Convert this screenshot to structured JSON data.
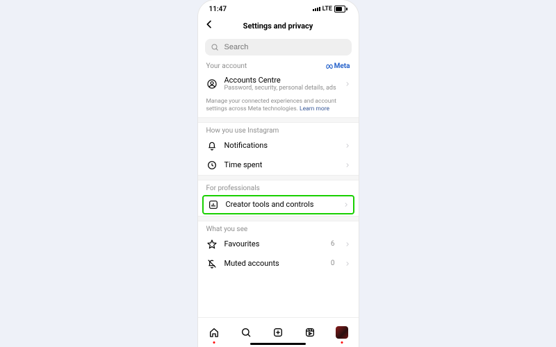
{
  "status": {
    "time": "11:47",
    "net": "LTE",
    "battery": "62"
  },
  "header": {
    "title": "Settings and privacy"
  },
  "search": {
    "placeholder": "Search"
  },
  "sections": {
    "account": {
      "header": "Your account",
      "brand": "Meta",
      "item": {
        "label": "Accounts Centre",
        "sub": "Password, security, personal details, ads"
      },
      "note": "Manage your connected experiences and account settings across Meta technologies.",
      "learn": "Learn more"
    },
    "use": {
      "header": "How you use Instagram",
      "items": [
        {
          "label": "Notifications"
        },
        {
          "label": "Time spent"
        }
      ]
    },
    "pro": {
      "header": "For professionals",
      "item": {
        "label": "Creator tools and controls"
      }
    },
    "see": {
      "header": "What you see",
      "items": [
        {
          "label": "Favourites",
          "value": "6"
        },
        {
          "label": "Muted accounts",
          "value": "0"
        }
      ]
    }
  }
}
